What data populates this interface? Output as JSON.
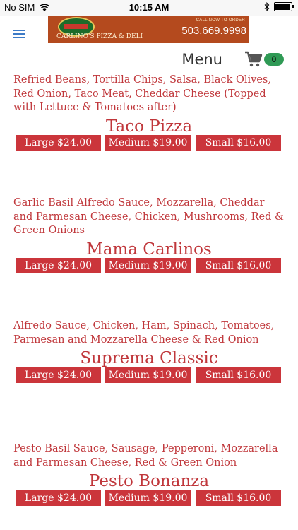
{
  "status": {
    "carrier": "No SIM",
    "time": "10:15 AM",
    "battery_level": 0.95
  },
  "header": {
    "logo_text": "CARLINO'S PIZZA & DELI",
    "call_text": "CALL NOW TO ORDER",
    "phone": "503.669.9998",
    "menu_label": "Menu",
    "cart_count": "0"
  },
  "items": [
    {
      "description": "Refried Beans, Tortilla Chips, Salsa, Black Olives, Red Onion, Taco Meat, Cheddar Cheese (Topped with Lettuce & Tomatoes after)",
      "name": "Taco Pizza",
      "large": "Large $24.00",
      "medium": "Medium $19.00",
      "small": "Small $16.00"
    },
    {
      "description": "Garlic Basil Alfredo Sauce, Mozzarella, Cheddar and Parmesan Cheese, Chicken, Mushrooms, Red & Green Onions",
      "name": "Mama Carlinos",
      "large": "Large $24.00",
      "medium": "Medium $19.00",
      "small": "Small $16.00"
    },
    {
      "description": "Alfredo Sauce, Chicken, Ham, Spinach, Tomatoes, Parmesan and Mozzarella Cheese & Red Onion",
      "name": "Suprema Classic",
      "large": "Large $24.00",
      "medium": "Medium $19.00",
      "small": "Small $16.00"
    },
    {
      "description": "Pesto Basil Sauce, Sausage, Pepperoni, Mozzarella and Parmesan Cheese, Red & Green Onion",
      "name": "Pesto Bonanza",
      "large": "Large $24.00",
      "medium": "Medium $19.00",
      "small": "Small $16.00"
    }
  ]
}
